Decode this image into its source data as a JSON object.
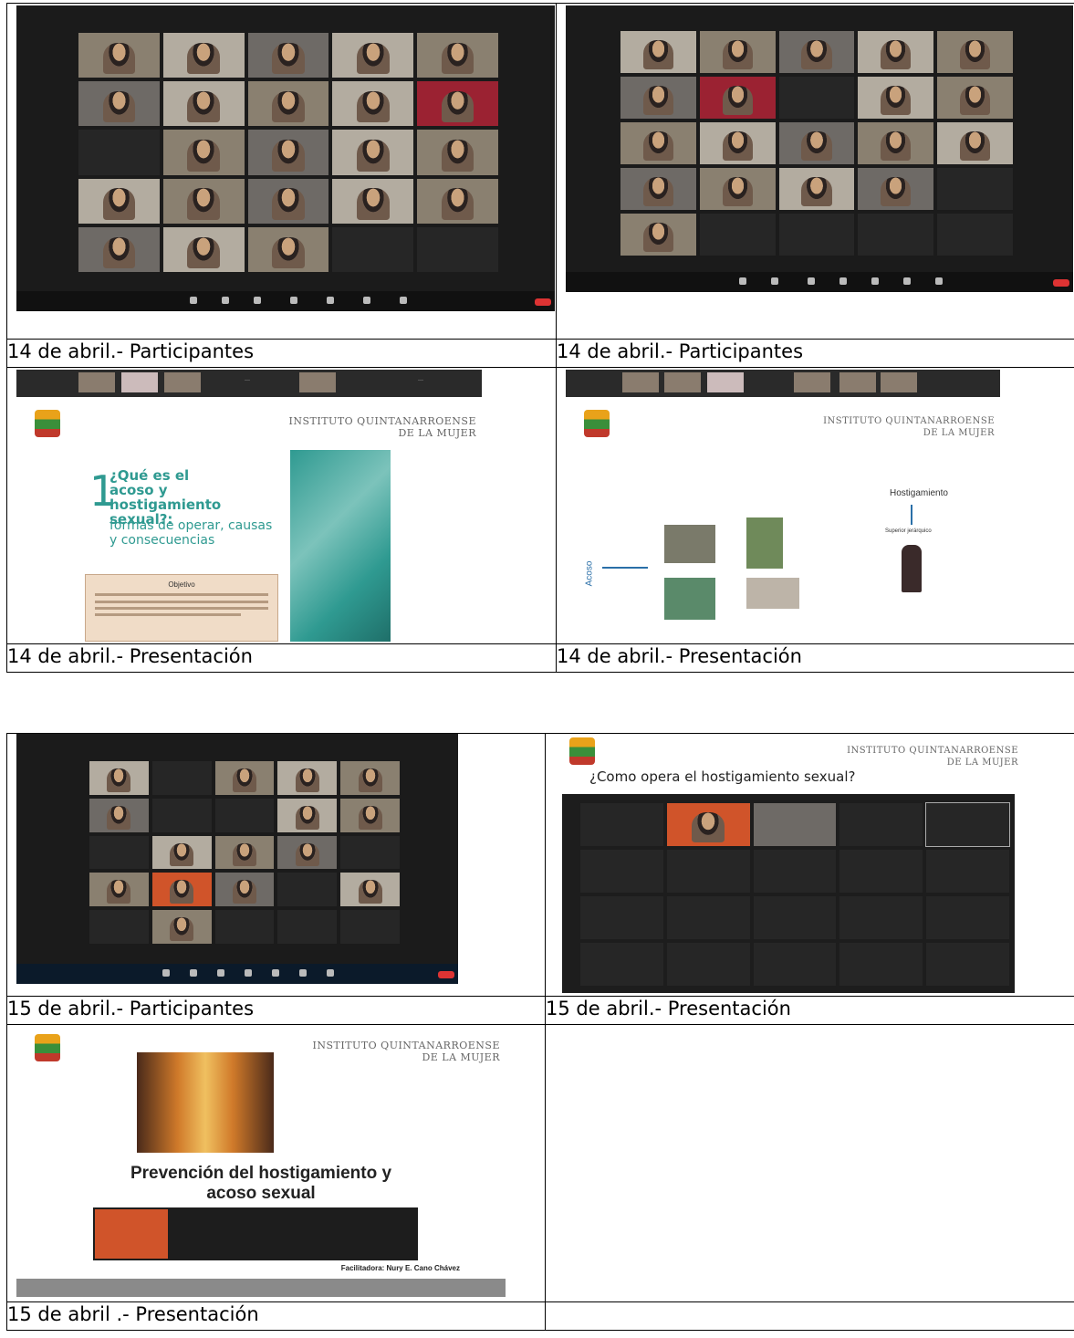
{
  "captions": {
    "c1": "14 de abril.- Participantes",
    "c2": "14 de abril.- Participantes",
    "c3": "14 de abril.- Presentación",
    "c4": "14 de abril.- Presentación",
    "c5": "15 de abril.- Participantes",
    "c6": "15 de abril.- Presentación",
    "c7": "15 de abril .- Presentación"
  },
  "slide_a": {
    "institute_line1": "INSTITUTO QUINTANARROENSE",
    "institute_line2": "DE LA MUJER",
    "number": "1",
    "question": "¿Qué es el acoso y hostigamiento sexual?:",
    "subtitle": "formas de operar, causas y consecuencias",
    "box_title": "Objetivo"
  },
  "slide_b": {
    "institute_line1": "INSTITUTO QUINTANARROENSE",
    "institute_line2": "DE LA MUJER",
    "acoso": "Acoso",
    "hostigamiento": "Hostigamiento",
    "superior": "Superior jerárquico"
  },
  "slide_c": {
    "institute_line1": "INSTITUTO QUINTANARROENSE",
    "institute_line2": "DE LA MUJER",
    "question": "¿Como opera el hostigamiento sexual?"
  },
  "slide_d": {
    "institute_line1": "INSTITUTO QUINTANARROENSE",
    "institute_line2": "DE LA MUJER",
    "title_line1": "Prevención del hostigamiento y",
    "title_line2": "acoso sexual",
    "facilitator": "Facilitadora: Nury E. Cano Chávez"
  },
  "colors": {
    "teal": "#2f9a91",
    "zoom_bg": "#1b1b1b",
    "red_tile": "#9b2232",
    "box": "#f0dcc7"
  }
}
